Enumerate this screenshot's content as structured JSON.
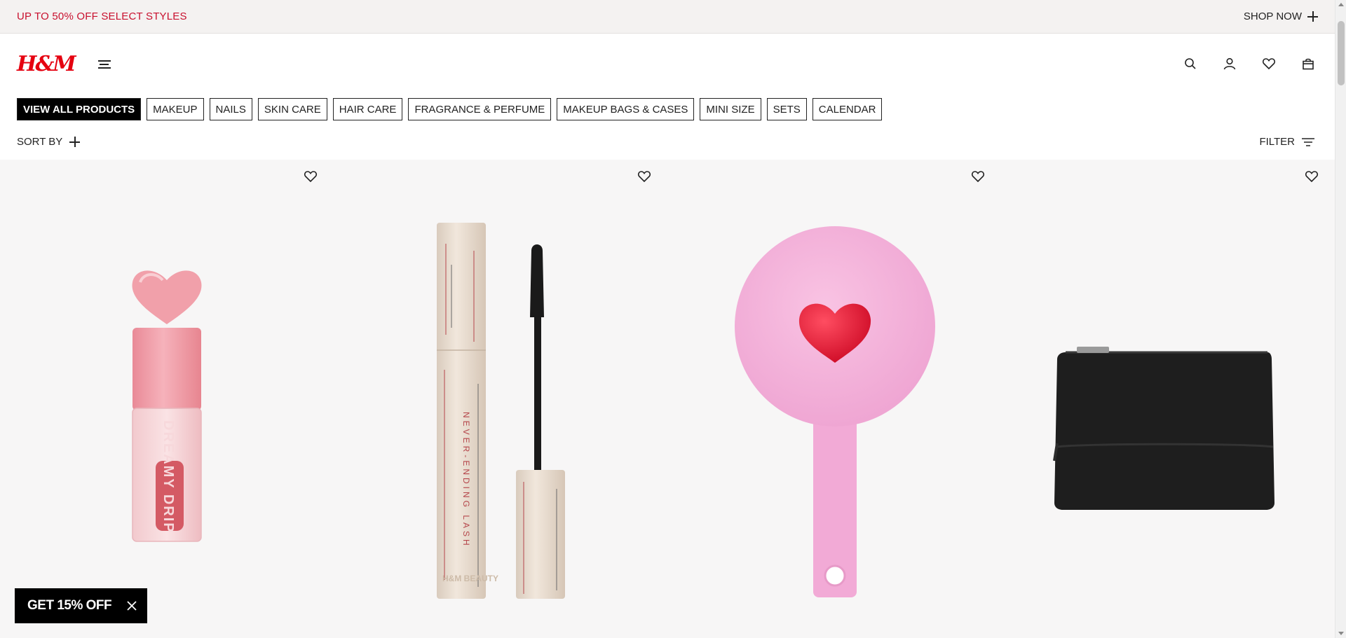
{
  "promo": {
    "text": "UP TO 50% OFF SELECT STYLES",
    "cta_label": "SHOP NOW",
    "text_color": "#c8102e"
  },
  "header": {
    "logo_text": "H&M",
    "brand_color": "#e50010",
    "icons": [
      "menu-icon",
      "search-icon",
      "account-icon",
      "heart-icon",
      "bag-icon"
    ]
  },
  "categories": [
    {
      "label": "VIEW ALL PRODUCTS",
      "active": true
    },
    {
      "label": "MAKEUP",
      "active": false
    },
    {
      "label": "NAILS",
      "active": false
    },
    {
      "label": "SKIN CARE",
      "active": false
    },
    {
      "label": "HAIR CARE",
      "active": false
    },
    {
      "label": "FRAGRANCE & PERFUME",
      "active": false
    },
    {
      "label": "MAKEUP BAGS & CASES",
      "active": false
    },
    {
      "label": "MINI SIZE",
      "active": false
    },
    {
      "label": "SETS",
      "active": false
    },
    {
      "label": "CALENDAR",
      "active": false
    }
  ],
  "toolbar": {
    "sort_label": "SORT BY",
    "filter_label": "FILTER"
  },
  "products": [
    {
      "image": "lip-oil-image",
      "image_text": "DREAMY DRIP"
    },
    {
      "image": "mascara-image",
      "image_text": "NEVER-ENDING LASH"
    },
    {
      "image": "heart-mirror-image"
    },
    {
      "image": "black-makeup-bag-image"
    }
  ],
  "popup": {
    "label": "GET 15% OFF"
  }
}
